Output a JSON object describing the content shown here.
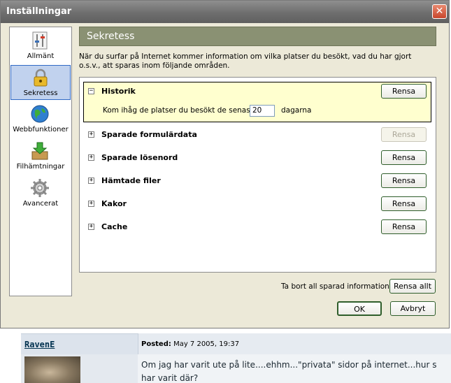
{
  "dialog": {
    "title": "Inställningar",
    "close_glyph": "✕"
  },
  "sidebar": {
    "items": [
      {
        "label": "Allmänt",
        "icon": "sliders-icon",
        "selected": false
      },
      {
        "label": "Sekretess",
        "icon": "padlock-icon",
        "selected": true
      },
      {
        "label": "Webbfunktioner",
        "icon": "globe-icon",
        "selected": false
      },
      {
        "label": "Filhämtningar",
        "icon": "download-box-icon",
        "selected": false
      },
      {
        "label": "Avancerat",
        "icon": "gear-icon",
        "selected": false
      }
    ]
  },
  "section": {
    "title": "Sekretess",
    "intro": "När du surfar på Internet kommer information om vilka platser du besökt, vad du har gjort o.s.v., att sparas inom följande områden."
  },
  "categories": [
    {
      "label": "Historik",
      "toggle": "−",
      "button": "Rensa",
      "expanded": true,
      "enabled": true
    },
    {
      "label": "Sparade formulärdata",
      "toggle": "+",
      "button": "Rensa",
      "expanded": false,
      "enabled": false
    },
    {
      "label": "Sparade lösenord",
      "toggle": "+",
      "button": "Rensa",
      "expanded": false,
      "enabled": true
    },
    {
      "label": "Hämtade filer",
      "toggle": "+",
      "button": "Rensa",
      "expanded": false,
      "enabled": true
    },
    {
      "label": "Kakor",
      "toggle": "+",
      "button": "Rensa",
      "expanded": false,
      "enabled": true
    },
    {
      "label": "Cache",
      "toggle": "+",
      "button": "Rensa",
      "expanded": false,
      "enabled": true
    }
  ],
  "history": {
    "remember_label": "Kom ihåg de platser du besökt de senaste",
    "days_value": "20",
    "days_suffix": "dagarna"
  },
  "footer": {
    "clear_all_label": "Ta bort all sparad information:",
    "clear_all_button": "Rensa allt",
    "ok_button": "OK",
    "cancel_button": "Avbryt"
  },
  "forum": {
    "author": "RavenE",
    "posted_label": "Posted:",
    "posted_date": "May 7 2005, 19:37",
    "post_text": "Om jag har varit ute på lite....ehhm...\"privata\" sidor på internet...hur s har varit där?"
  },
  "colors": {
    "header_bar": "#8a9173",
    "selected_item": "#c1d2ee",
    "expanded_bg": "#ffffcf",
    "button_border": "#2f5e2b"
  }
}
